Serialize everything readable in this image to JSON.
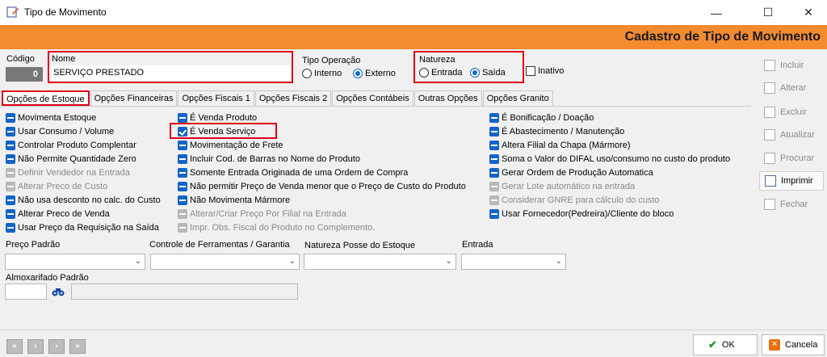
{
  "window": {
    "title": "Tipo de Movimento",
    "minimize": "—",
    "maximize": "☐",
    "close": "✕"
  },
  "header": {
    "title": "Cadastro de Tipo de Movimento"
  },
  "fields": {
    "codigo_label": "Código",
    "codigo_value": "0",
    "nome_label": "Nome",
    "nome_value": "SERVIÇO PRESTADO",
    "tipo_operacao_label": "Tipo Operação",
    "tipo_operacao_options": [
      "Interno",
      "Externo"
    ],
    "tipo_operacao_selected": "Externo",
    "natureza_label": "Natureza",
    "natureza_options": [
      "Entrada",
      "Saída"
    ],
    "natureza_selected": "Saída",
    "inativo_label": "Inativo"
  },
  "tabs": [
    "Opções de Estoque",
    "Opções Financeiras",
    "Opções Fiscais 1",
    "Opções Fiscais 2",
    "Opções Contábeis",
    "Outras Opções",
    "Opções Granito"
  ],
  "options": {
    "col1": [
      {
        "label": "Movimenta Estoque",
        "state": "on"
      },
      {
        "label": "Usar Consumo / Volume",
        "state": "on"
      },
      {
        "label": "Controlar Produto Complentar",
        "state": "on"
      },
      {
        "label": "Não Permite Quantidade Zero",
        "state": "on"
      },
      {
        "label": "Definir Vendedor na Entrada",
        "state": "disabled"
      },
      {
        "label": "Alterar Preco de Custo",
        "state": "disabled"
      },
      {
        "label": "Não usa desconto no calc. do Custo",
        "state": "on"
      },
      {
        "label": "Alterar Preco de Venda",
        "state": "on"
      },
      {
        "label": "Usar Preço da Requisição na Saída",
        "state": "on"
      }
    ],
    "col2": [
      {
        "label": "É Venda Produto",
        "state": "on"
      },
      {
        "label": "É Venda Serviço",
        "state": "checked"
      },
      {
        "label": "Movimentação de Frete",
        "state": "on"
      },
      {
        "label": "Incluir Cod. de Barras no Nome do Produto",
        "state": "on"
      },
      {
        "label": "Somente Entrada Originada de uma Ordem de Compra",
        "state": "on"
      },
      {
        "label": "Não permitir Preço de Venda menor que o Preço de Custo do Produto",
        "state": "on"
      },
      {
        "label": "Não Movimenta Mármore",
        "state": "on"
      },
      {
        "label": "Alterar/Criar Preço Por Filial na Entrada",
        "state": "disabled"
      },
      {
        "label": "Impr. Obs. Fiscal do Produto no Complemento.",
        "state": "disabled"
      }
    ],
    "col3": [
      {
        "label": "É Bonificação / Doação",
        "state": "on"
      },
      {
        "label": "É Abastecimento / Manutenção",
        "state": "on"
      },
      {
        "label": "Altera Filial da Chapa (Mármore)",
        "state": "on"
      },
      {
        "label": "Soma o Valor do DIFAL uso/consumo no custo do produto",
        "state": "on"
      },
      {
        "label": "Gerar Ordem de Produção Automatica",
        "state": "on"
      },
      {
        "label": "Gerar Lote automático na entrada",
        "state": "disabled"
      },
      {
        "label": "Considerar GNRE para cálculo do custo",
        "state": "disabled"
      },
      {
        "label": "Usar Fornecedor(Pedreira)/Cliente do bloco",
        "state": "on"
      }
    ]
  },
  "combos": {
    "preco_padrao_label": "Preço Padrão",
    "controle_label": "Controle de Ferramentas / Garantia",
    "natureza_posse_label": "Natureza Posse do Estoque",
    "entrada_label": "Entrada",
    "almoxarifado_label": "Almoxarifado Padrão"
  },
  "sidebar": [
    "Incluir",
    "Alterar",
    "Excluir",
    "Atualizar",
    "Procurar",
    "Imprimir",
    "Fechar"
  ],
  "footer": {
    "ok": "OK",
    "cancel": "Cancela",
    "nav": [
      "«",
      "‹",
      "›",
      "»"
    ]
  }
}
